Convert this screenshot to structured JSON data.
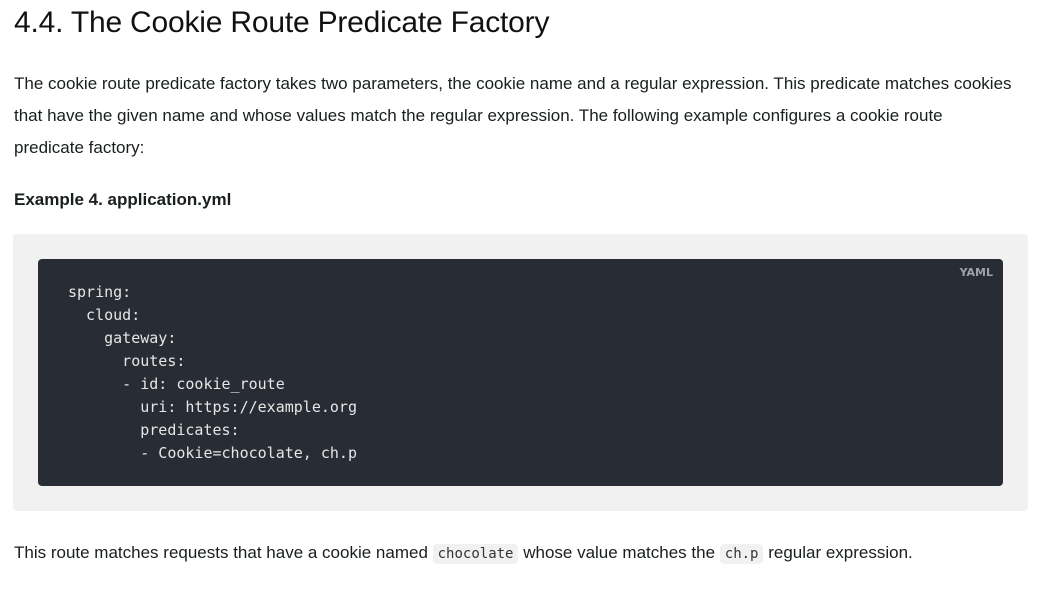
{
  "heading": "4.4. The Cookie Route Predicate Factory",
  "intro": "The cookie route predicate factory takes two parameters, the cookie name and a regular expression. This predicate matches cookies that have the given name and whose values match the regular expression. The following example configures a cookie route predicate factory:",
  "example_title": "Example 4. application.yml",
  "code_block": {
    "language": "YAML",
    "code": "spring:\n  cloud:\n    gateway:\n      routes:\n      - id: cookie_route\n        uri: https://example.org\n        predicates:\n        - Cookie=chocolate, ch.p"
  },
  "summary": {
    "part1": "This route matches requests that have a cookie named ",
    "code1": "chocolate",
    "part2": " whose value matches the ",
    "code2": "ch.p",
    "part3": " regular expression."
  }
}
